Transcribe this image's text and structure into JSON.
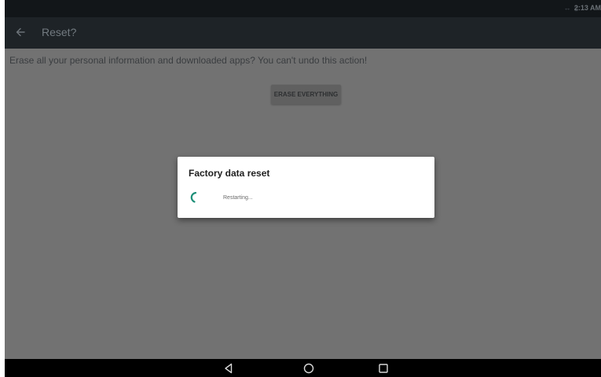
{
  "status_bar": {
    "icons": "↔ ▯",
    "time": "2:13 AM"
  },
  "toolbar": {
    "back_icon": "arrow-left-icon",
    "title": "Reset?"
  },
  "content": {
    "warning": "Erase all your personal information and downloaded apps? You can't undo this action!",
    "erase_button_label": "ERASE EVERYTHING"
  },
  "dialog": {
    "title": "Factory data reset",
    "message": "Restarting...",
    "spinner_icon": "progress-spinner-icon",
    "accent_color": "#1d8f78"
  },
  "nav_bar": {
    "back_icon": "nav-back-triangle-icon",
    "home_icon": "nav-home-circle-icon",
    "recents_icon": "nav-recents-square-icon"
  }
}
